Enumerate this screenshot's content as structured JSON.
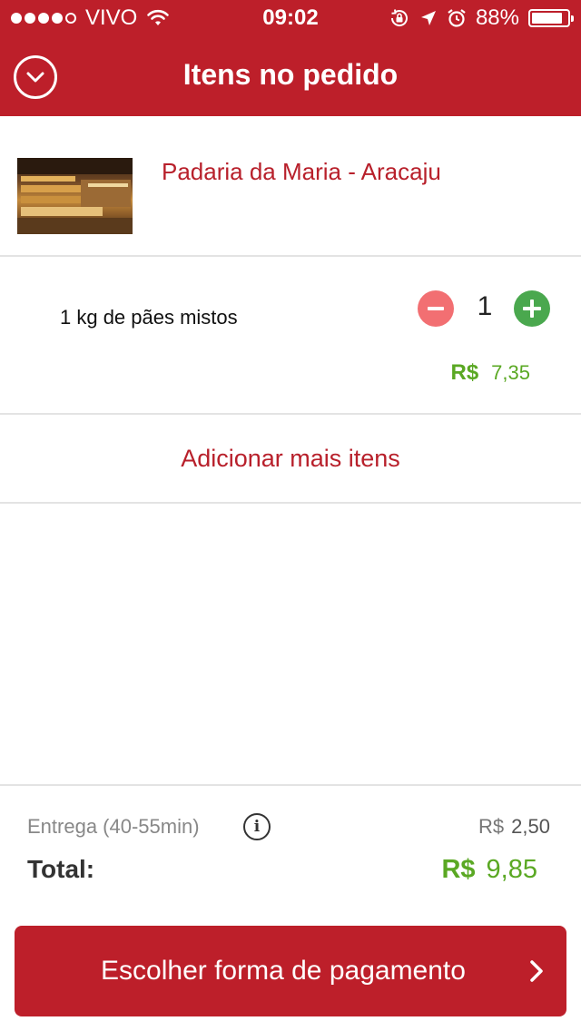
{
  "status_bar": {
    "carrier": "VIVO",
    "time": "09:02",
    "battery": "88%",
    "battery_level": 0.88
  },
  "header": {
    "title": "Itens no pedido",
    "back_icon": "chevron-down-circle-icon"
  },
  "store": {
    "name": "Padaria da Maria - Aracaju"
  },
  "item": {
    "name": "1 kg de pães mistos",
    "quantity": "1",
    "currency": "R$",
    "price": "7,35"
  },
  "add_more_label": "Adicionar mais itens",
  "summary": {
    "delivery_label": "Entrega (40-55min)",
    "delivery_currency": "R$",
    "delivery_price": "2,50",
    "total_label": "Total:",
    "total_currency": "R$",
    "total_price": "9,85"
  },
  "checkout_button": {
    "label": "Escolher forma de pagamento"
  },
  "colors": {
    "brand_red": "#bd1f2a",
    "price_green": "#5aa823",
    "minus_red": "#f26f72",
    "plus_green": "#4aa84e"
  }
}
